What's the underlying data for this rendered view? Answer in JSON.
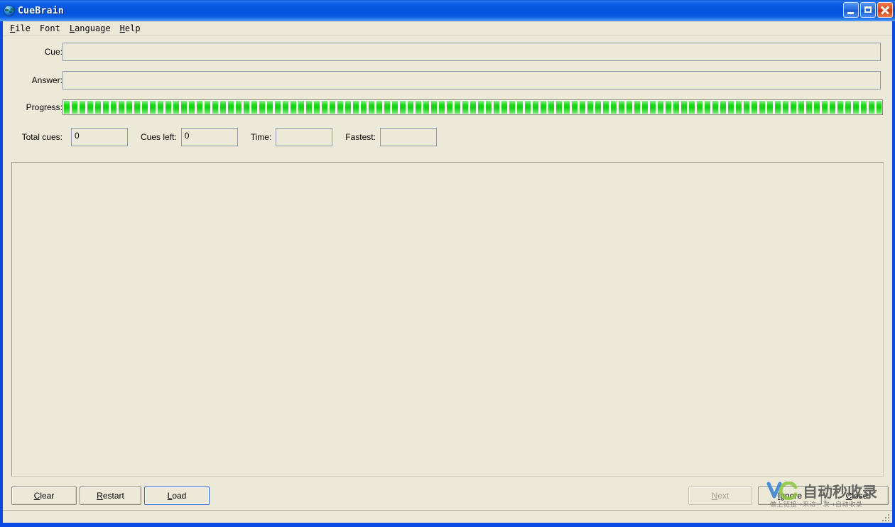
{
  "window": {
    "title": "CueBrain",
    "icon": "globe-icon",
    "controls": {
      "minimize": "minimize-button",
      "maximize": "maximize-button",
      "close": "close-button"
    }
  },
  "menubar": {
    "items": [
      {
        "label": "File",
        "accel": "F",
        "rest": "ile"
      },
      {
        "label": "Font",
        "accel": "",
        "rest": "Font"
      },
      {
        "label": "Language",
        "accel": "L",
        "rest": "anguage"
      },
      {
        "label": "Help",
        "accel": "H",
        "rest": "elp"
      }
    ]
  },
  "form": {
    "cue": {
      "label": "Cue:",
      "value": "",
      "placeholder": ""
    },
    "answer": {
      "label": "Answer:",
      "value": "",
      "placeholder": ""
    },
    "progress": {
      "label": "Progress:",
      "percent": 100
    },
    "stats": {
      "total_cues": {
        "label": "Total cues:",
        "value": "0"
      },
      "cues_left": {
        "label": "Cues left:",
        "value": "0"
      },
      "time": {
        "label": "Time:",
        "value": ""
      },
      "fastest": {
        "label": "Fastest:",
        "value": ""
      }
    }
  },
  "content": {
    "text": ""
  },
  "buttons": {
    "clear": {
      "label": "Clear",
      "accel": "C",
      "rest": "lear",
      "state": "enabled"
    },
    "restart": {
      "label": "Restart",
      "accel": "R",
      "rest": "estart",
      "state": "enabled"
    },
    "load": {
      "label": "Load",
      "accel": "L",
      "rest": "oad",
      "state": "focused"
    },
    "next": {
      "label": "Next",
      "accel": "N",
      "rest": "ext",
      "state": "disabled"
    },
    "ignore": {
      "label": "Ignore",
      "accel": "I",
      "rest": "gnore",
      "state": "enabled"
    },
    "close": {
      "label": "Close",
      "accel": "C",
      "rest": "lose",
      "state": "enabled"
    }
  },
  "statusbar": {
    "text": ""
  },
  "watermark": {
    "title": "自动秒收录",
    "subtitle": "做上链接→来访一次→自动收录",
    "logo": "vc-logo"
  },
  "colors": {
    "window_face": "#ECE9D8",
    "title_blue": "#0A58E0",
    "progress_green": "#12D412",
    "field_border": "#8A9BA8",
    "focus_blue": "#2F66C9"
  }
}
